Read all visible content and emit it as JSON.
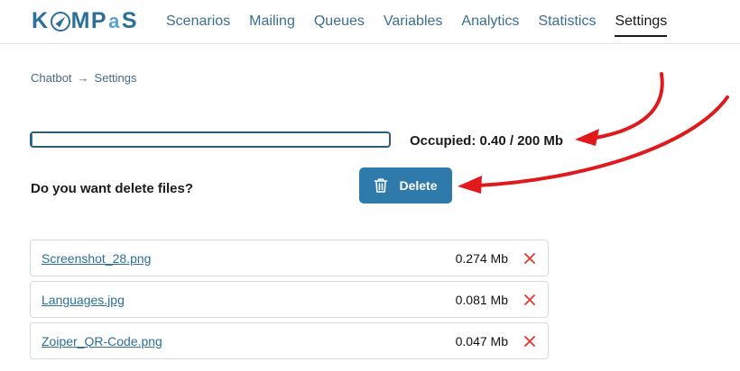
{
  "logo": {
    "pre": "K",
    "mid": "MP",
    "post": "S",
    "at": "a"
  },
  "nav": [
    {
      "label": "Scenarios",
      "active": false
    },
    {
      "label": "Mailing",
      "active": false
    },
    {
      "label": "Queues",
      "active": false
    },
    {
      "label": "Variables",
      "active": false
    },
    {
      "label": "Analytics",
      "active": false
    },
    {
      "label": "Statistics",
      "active": false
    },
    {
      "label": "Settings",
      "active": true
    }
  ],
  "breadcrumb": {
    "parent": "Chatbot",
    "current": "Settings"
  },
  "storage": {
    "used_fraction": 0.002,
    "label": "Occupied: 0.40 / 200 Mb"
  },
  "delete_section": {
    "question": "Do you want delete files?",
    "button_label": "Delete"
  },
  "files": [
    {
      "name": "Screenshot_28.png",
      "size": "0.274 Mb"
    },
    {
      "name": "Languages.jpg",
      "size": "0.081 Mb"
    },
    {
      "name": "Zoiper_QR-Code.png",
      "size": "0.047 Mb"
    }
  ],
  "colors": {
    "accent": "#2e7bab",
    "remove_icon": "#e5342b",
    "annotation_arrow": "#e0191c"
  },
  "icons": {
    "delete": "trash-icon",
    "remove": "close-icon"
  }
}
